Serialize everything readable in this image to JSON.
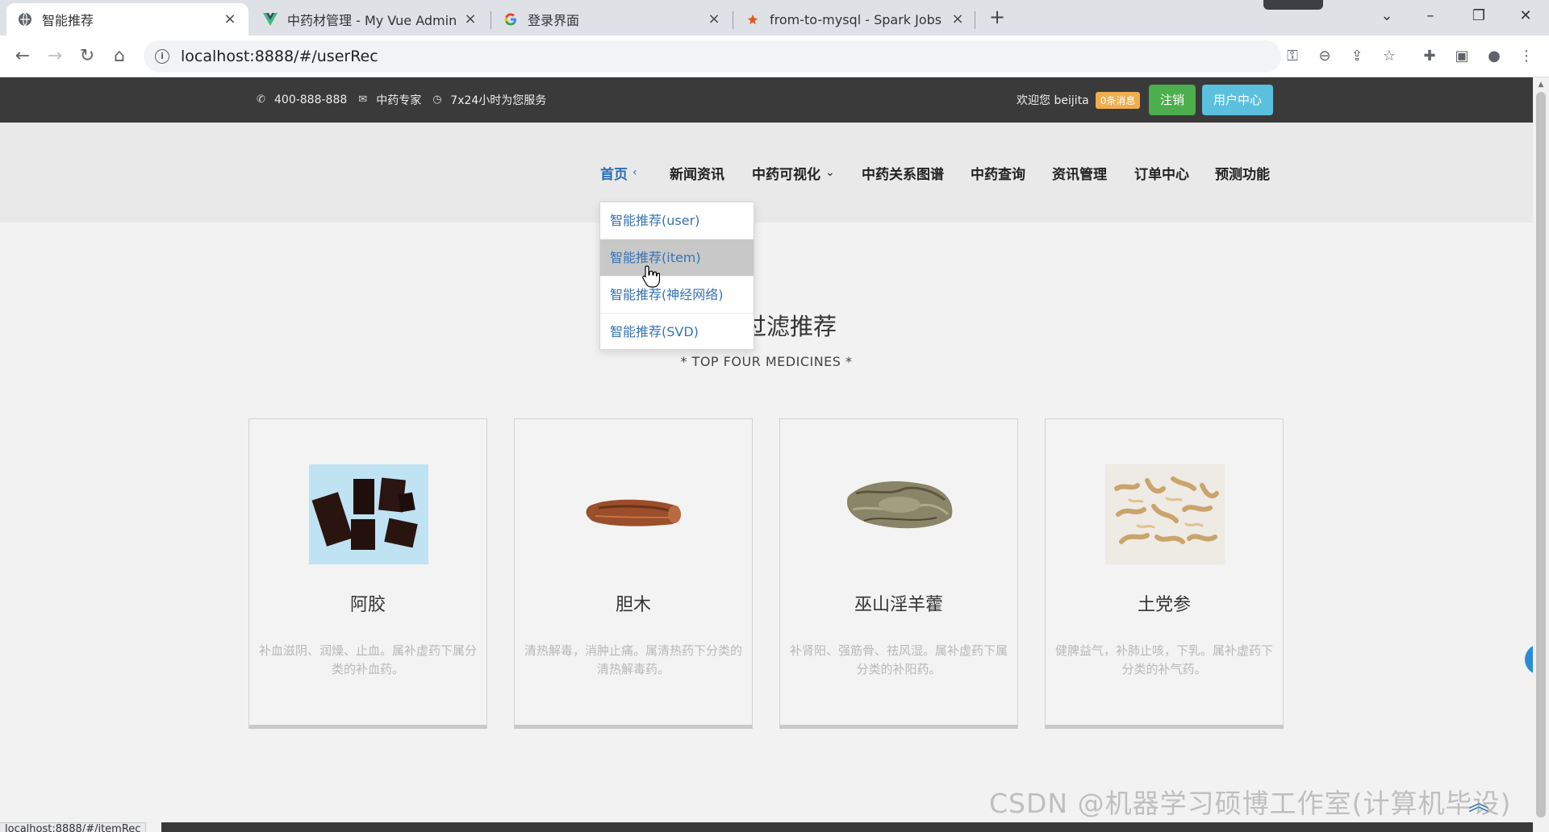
{
  "browser": {
    "tabs": [
      {
        "title": "智能推荐",
        "favicon": "globe-icon",
        "active": true
      },
      {
        "title": "中药材管理 - My Vue Admin",
        "favicon": "vue-logo-icon"
      },
      {
        "title": "登录界面",
        "favicon": "google-logo-icon"
      },
      {
        "title": "from-to-mysql - Spark Jobs",
        "favicon": "spark-logo-icon"
      }
    ],
    "url": "localhost:8888/#/userRec",
    "status_url": "localhost:8888/#/itemRec"
  },
  "topbar": {
    "phone": "400-888-888",
    "expert": "中药专家",
    "service": "7x24小时为您服务",
    "welcome": "欢迎您 beijita",
    "messages_badge": "0条消息",
    "logout_label": "注销",
    "user_center_label": "用户中心"
  },
  "nav": {
    "items": [
      {
        "label": "首页",
        "caret": "‹"
      },
      {
        "label": "新闻资讯"
      },
      {
        "label": "中药可视化",
        "caret": "⌄"
      },
      {
        "label": "中药关系图谱"
      },
      {
        "label": "中药查询"
      },
      {
        "label": "资讯管理"
      },
      {
        "label": "订单中心"
      },
      {
        "label": "预测功能"
      }
    ],
    "dropdown": [
      "智能推荐(user)",
      "智能推荐(item)",
      "智能推荐(神经网络)",
      "智能推荐(SVD)"
    ]
  },
  "section": {
    "title": "协同过滤推荐",
    "subtitle": "* TOP FOUR MEDICINES *"
  },
  "cards": [
    {
      "name": "阿胶",
      "desc": "补血滋阴、润燥、止血。属补虚药下属分类的补血药。"
    },
    {
      "name": "胆木",
      "desc": "清热解毒，消肿止痛。属清热药下分类的清热解毒药。"
    },
    {
      "name": "巫山淫羊藿",
      "desc": "补肾阳、强筋骨、祛风湿。属补虚药下属分类的补阳药。"
    },
    {
      "name": "土党参",
      "desc": "健脾益气，补肺止咳，下乳。属补虚药下分类的补气药。"
    }
  ],
  "watermark": "CSDN @机器学习硕博工作室(计算机毕设)"
}
